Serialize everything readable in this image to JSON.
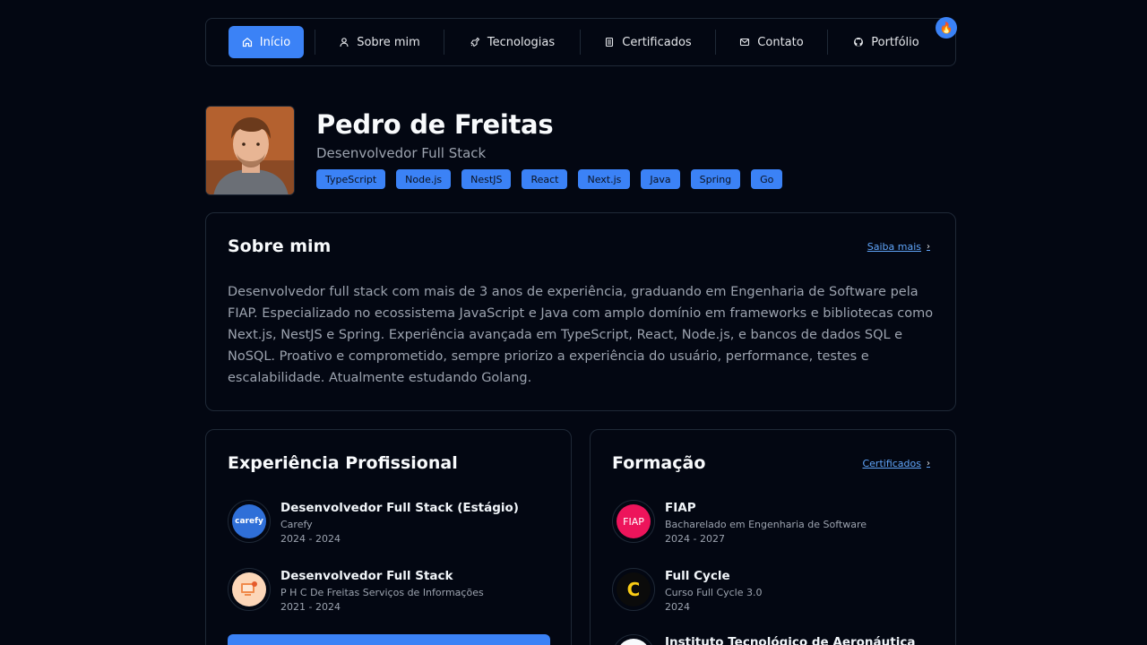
{
  "nav": {
    "items": [
      {
        "label": "Início",
        "icon": "home-icon"
      },
      {
        "label": "Sobre mim",
        "icon": "user-icon"
      },
      {
        "label": "Tecnologias",
        "icon": "rocket-icon"
      },
      {
        "label": "Certificados",
        "icon": "document-icon"
      },
      {
        "label": "Contato",
        "icon": "mail-icon"
      },
      {
        "label": "Portfólio",
        "icon": "github-icon"
      }
    ],
    "badge": "🔥",
    "accent": "#3b82f6"
  },
  "profile": {
    "name": "Pedro de Freitas",
    "role": "Desenvolvedor Full Stack",
    "tags": [
      "TypeScript",
      "Node.js",
      "NestJS",
      "React",
      "Next.js",
      "Java",
      "Spring",
      "Go"
    ]
  },
  "about": {
    "title": "Sobre mim",
    "link": "Saiba mais",
    "text": "Desenvolvedor full stack com mais de 3 anos de experiência, graduando em Engenharia de Software pela FIAP. Especializado no ecossistema JavaScript e Java com amplo domínio em frameworks e bibliotecas como Next.js, NestJS e Spring. Experiência avançada em TypeScript, React, Node.js, e bancos de dados SQL e NoSQL. Proativo e comprometido, sempre priorizo a experiência do usuário, performance, testes e escalabilidade. Atualmente estudando Golang."
  },
  "experience": {
    "title": "Experiência Profissional",
    "items": [
      {
        "title": "Desenvolvedor Full Stack (Estágio)",
        "company": "Carefy",
        "period": "2024 - 2024",
        "logo_text": "carefy"
      },
      {
        "title": "Desenvolvedor Full Stack",
        "company": "P H C De Freitas Serviços de Informações",
        "period": "2021 - 2024",
        "logo_text": ""
      }
    ]
  },
  "education": {
    "title": "Formação",
    "link": "Certificados",
    "items": [
      {
        "title": "FIAP",
        "course": "Bacharelado em Engenharia de Software",
        "period": "2024 - 2027",
        "logo_text": "FIAP"
      },
      {
        "title": "Full Cycle",
        "course": "Curso Full Cycle 3.0",
        "period": "2024",
        "logo_text": "C"
      },
      {
        "title": "Instituto Tecnológico de Aeronáutica",
        "course": "",
        "period": "",
        "logo_text": ""
      }
    ]
  }
}
